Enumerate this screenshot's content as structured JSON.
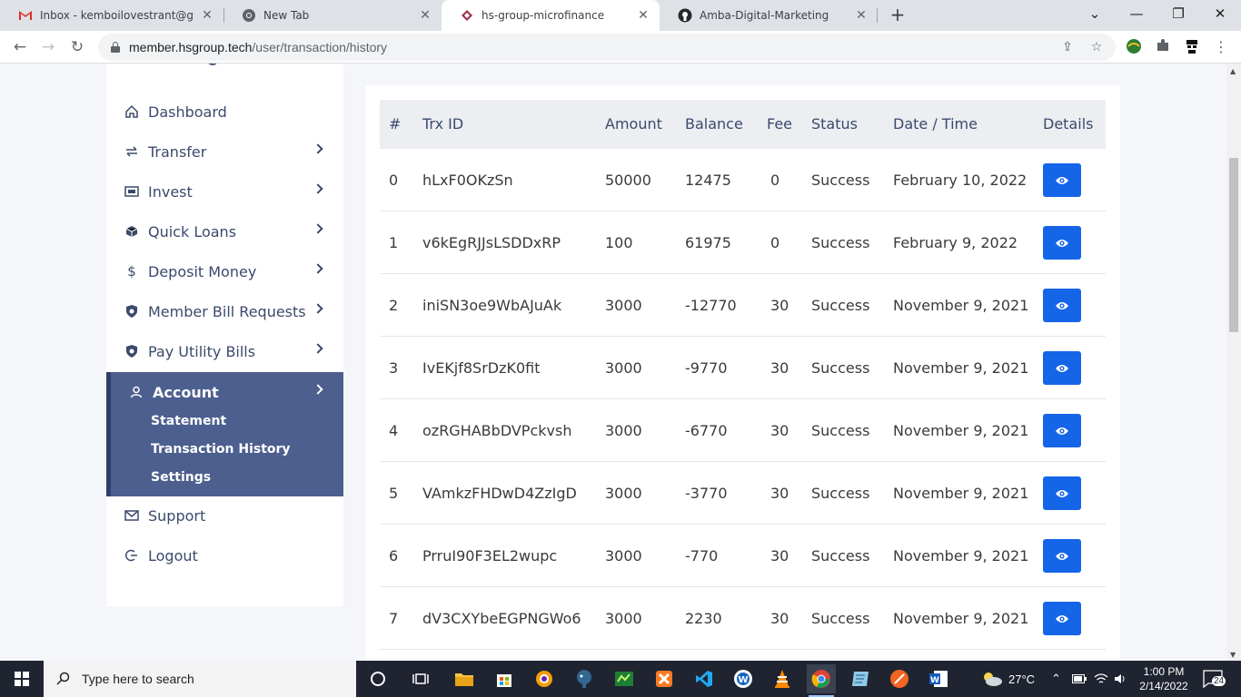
{
  "browser": {
    "tabs": [
      {
        "title": "Inbox - kemboilovestrant@gmail.com",
        "icon": "gmail-icon",
        "active": false
      },
      {
        "title": "New Tab",
        "icon": "chrome-icon",
        "active": false
      },
      {
        "title": "hs-group-microfinance",
        "icon": "site-icon",
        "active": true
      },
      {
        "title": "Amba-Digital-Marketing",
        "icon": "github-icon",
        "active": false
      }
    ],
    "url_host": "member.hsgroup.tech",
    "url_path": "/user/transaction/history"
  },
  "sidebar": {
    "items": [
      {
        "label": "Dashboard",
        "icon": "home-icon",
        "has_chevron": false
      },
      {
        "label": "Transfer",
        "icon": "transfer-icon",
        "has_chevron": true
      },
      {
        "label": "Invest",
        "icon": "money-icon",
        "has_chevron": true
      },
      {
        "label": "Quick Loans",
        "icon": "box-icon",
        "has_chevron": true
      },
      {
        "label": "Deposit Money",
        "icon": "dollar-icon",
        "has_chevron": true
      },
      {
        "label": "Member Bill Requests",
        "icon": "shield-icon",
        "has_chevron": true
      },
      {
        "label": "Pay Utility Bills",
        "icon": "shield-icon",
        "has_chevron": true
      }
    ],
    "account": {
      "label": "Account",
      "sub_items": [
        "Statement",
        "Transaction History",
        "Settings"
      ]
    },
    "support_label": "Support",
    "logout_label": "Logout"
  },
  "table": {
    "headers": [
      "#",
      "Trx ID",
      "Amount",
      "Balance",
      "Fee",
      "Status",
      "Date / Time",
      "Details"
    ],
    "rows": [
      {
        "num": "0",
        "trx": "hLxF0OKzSn",
        "amount": "50000",
        "balance": "12475",
        "fee": "0",
        "status": "Success",
        "date": "February 10, 2022"
      },
      {
        "num": "1",
        "trx": "v6kEgRJJsLSDDxRP",
        "amount": "100",
        "balance": "61975",
        "fee": "0",
        "status": "Success",
        "date": "February 9, 2022"
      },
      {
        "num": "2",
        "trx": "iniSN3oe9WbAJuAk",
        "amount": "3000",
        "balance": "-12770",
        "fee": "30",
        "status": "Success",
        "date": "November 9, 2021"
      },
      {
        "num": "3",
        "trx": "IvEKjf8SrDzK0fit",
        "amount": "3000",
        "balance": "-9770",
        "fee": "30",
        "status": "Success",
        "date": "November 9, 2021"
      },
      {
        "num": "4",
        "trx": "ozRGHABbDVPckvsh",
        "amount": "3000",
        "balance": "-6770",
        "fee": "30",
        "status": "Success",
        "date": "November 9, 2021"
      },
      {
        "num": "5",
        "trx": "VAmkzFHDwD4ZzIgD",
        "amount": "3000",
        "balance": "-3770",
        "fee": "30",
        "status": "Success",
        "date": "November 9, 2021"
      },
      {
        "num": "6",
        "trx": "PrruI90F3EL2wupc",
        "amount": "3000",
        "balance": "-770",
        "fee": "30",
        "status": "Success",
        "date": "November 9, 2021"
      },
      {
        "num": "7",
        "trx": "dV3CXYbeEGPNGWo6",
        "amount": "3000",
        "balance": "2230",
        "fee": "30",
        "status": "Success",
        "date": "November 9, 2021"
      }
    ]
  },
  "taskbar": {
    "search_placeholder": "Type here to search",
    "weather": "27°C",
    "time": "1:00 PM",
    "date": "2/14/2022",
    "notification_count": "24"
  },
  "colors": {
    "accent": "#1565e8",
    "sidebar_active": "#4d5f8e",
    "sidebar_text": "#3b4a6b"
  }
}
